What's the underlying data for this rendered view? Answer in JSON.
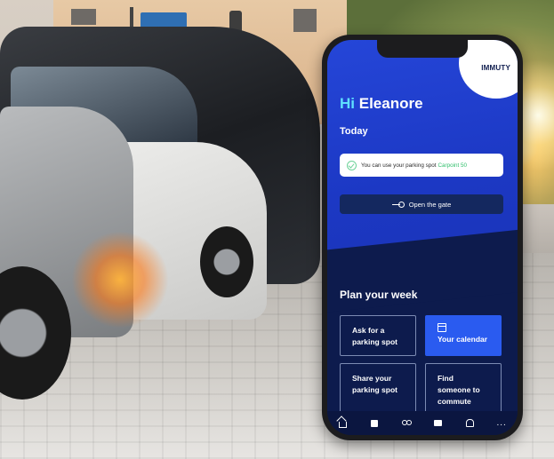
{
  "brand": {
    "logo_text": "IMMUTY"
  },
  "greeting": {
    "hi": "Hi",
    "name": "Eleanore"
  },
  "today": {
    "heading": "Today"
  },
  "parking_notice": {
    "text": "You can use your parking spot",
    "spot": "Carpoint 50"
  },
  "gate": {
    "label": "Open the gate"
  },
  "plan": {
    "heading": "Plan your week",
    "tiles": [
      {
        "label_line1": "Ask for a",
        "label_line2": "parking spot"
      },
      {
        "label": "Your calendar"
      },
      {
        "label_line1": "Share your",
        "label_line2": "parking spot"
      },
      {
        "label_line1": "Find",
        "label_line2": "someone to",
        "label_line3": "commute"
      }
    ]
  },
  "tabbar": {
    "more": "..."
  },
  "colors": {
    "accent_blue": "#2a5bf0",
    "header_blue": "#2546d8",
    "dark_navy": "#0d1b4d",
    "success_green": "#2fbf6b"
  }
}
